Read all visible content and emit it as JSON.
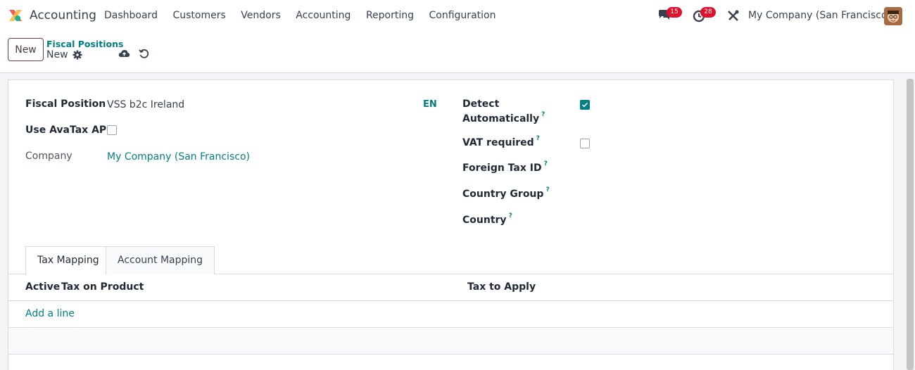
{
  "nav": {
    "app_name": "Accounting",
    "menu": [
      "Dashboard",
      "Customers",
      "Vendors",
      "Accounting",
      "Reporting",
      "Configuration"
    ],
    "messages_count": "15",
    "activities_count": "28",
    "company": "My Company (San Francisco)"
  },
  "control": {
    "new_label": "New",
    "breadcrumb_parent": "Fiscal Positions",
    "breadcrumb_current": "New"
  },
  "form": {
    "fiscal_position_label": "Fiscal Position",
    "fiscal_position_value": "VSS b2c Ireland",
    "lang": "EN",
    "use_avatax_label": "Use AvaTax API",
    "use_avatax_checked": false,
    "company_label": "Company",
    "company_value": "My Company (San Francisco)",
    "detect_label_1": "Detect",
    "detect_label_2": "Automatically",
    "detect_checked": true,
    "vat_required_label": "VAT required",
    "vat_required_checked": false,
    "foreign_tax_label": "Foreign Tax ID",
    "country_group_label": "Country Group",
    "country_label": "Country",
    "help_mark": "?"
  },
  "tabs": [
    "Tax Mapping",
    "Account Mapping"
  ],
  "table": {
    "columns": [
      "Active",
      "Tax on Product",
      "Tax to Apply"
    ],
    "add_line": "Add a line"
  },
  "colors": {
    "accent": "#017e84",
    "brand": "#71394f",
    "badge": "#e0112b"
  }
}
